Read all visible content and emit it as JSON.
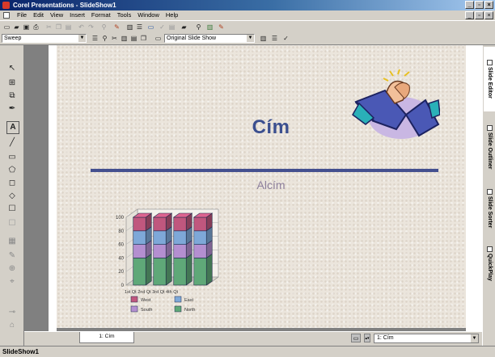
{
  "window": {
    "title": "Corel Presentations - SlideShow1",
    "min_glyph": "_",
    "max_glyph": "▫",
    "close_glyph": "×"
  },
  "menubar": {
    "items": [
      "File",
      "Edit",
      "View",
      "Insert",
      "Format",
      "Tools",
      "Window",
      "Help"
    ]
  },
  "toolbar2": {
    "style_dropdown": "Sweep",
    "slide_show_dropdown": "Original Slide Show"
  },
  "toolbar_icons": {
    "new": "▭",
    "open": "▰",
    "save": "▣",
    "print": "⎙",
    "cut": "✂",
    "copy": "❐",
    "paste": "▤",
    "undo": "↶",
    "redo": "↷",
    "zoom": "⚲",
    "chart": "▥",
    "bullets": "☰",
    "spell": "✓",
    "search": "⚲",
    "pencil": "✎"
  },
  "tools": [
    "↖",
    "⊞",
    "⧉",
    "✒",
    "A",
    "╱",
    "▭",
    "⬠",
    "◻",
    "◇",
    "☐",
    "☐",
    "▦",
    "✎",
    "⊕",
    "⌖",
    "⊸",
    "⌂"
  ],
  "slide": {
    "title": "Cím",
    "subtitle": "Alcím"
  },
  "chart_data": {
    "type": "bar",
    "stacked": true,
    "categories": [
      "1st Qtr",
      "2nd Qtr",
      "3rd Qtr",
      "4th Qtr"
    ],
    "category_labels_printed": "1st Qt 2nd Qt 3rd Qt 4th Qt",
    "series": [
      {
        "name": "North",
        "values": [
          40,
          40,
          40,
          40
        ],
        "color": "#5fa878"
      },
      {
        "name": "South",
        "values": [
          20,
          20,
          20,
          20
        ],
        "color": "#b48fd0"
      },
      {
        "name": "East",
        "values": [
          20,
          20,
          20,
          20
        ],
        "color": "#7ea8d8"
      },
      {
        "name": "West",
        "values": [
          20,
          20,
          20,
          20
        ],
        "color": "#c0577e"
      }
    ],
    "yticks": [
      0,
      20,
      40,
      60,
      80,
      100
    ],
    "ylim": [
      0,
      100
    ],
    "grid": true,
    "legend_position": "bottom"
  },
  "sidetabs": [
    "Slide Editor",
    "Slide Outliner",
    "Slide Sorter",
    "QuickPlay"
  ],
  "bottom": {
    "slide_tab": "1: Cím",
    "slide_select": "1: Cím"
  },
  "status": {
    "text": "SlideShow1"
  },
  "colors": {
    "title_blue": "#3b4f8f",
    "rule_blue": "#44508f",
    "subtitle_mauve": "#8d7f9c",
    "titlebar": "#0a246a"
  }
}
